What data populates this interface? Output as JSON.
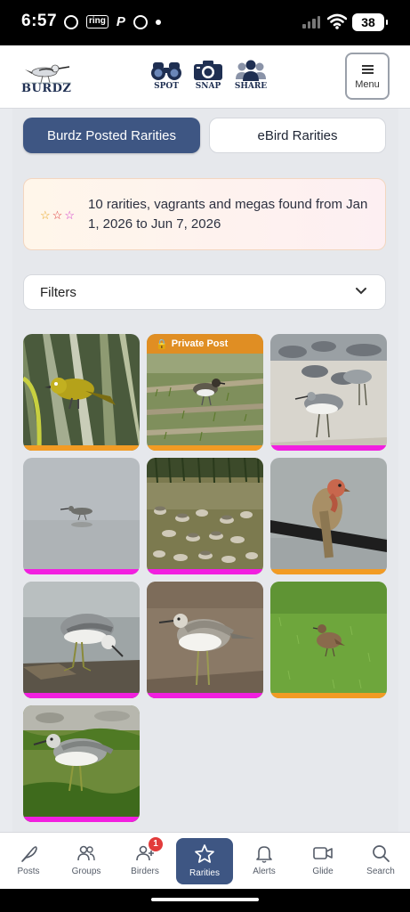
{
  "status_bar": {
    "time": "6:57",
    "ring_label": "ring",
    "battery": "38"
  },
  "header": {
    "logo_text": "BURDZ",
    "nav": [
      {
        "label": "SPOT",
        "icon": "binoculars-icon"
      },
      {
        "label": "SNAP",
        "icon": "camera-icon"
      },
      {
        "label": "SHARE",
        "icon": "people-icon"
      }
    ],
    "menu_label": "Menu"
  },
  "tabs": {
    "active": "Burdz Posted Rarities",
    "inactive": "eBird Rarities"
  },
  "info": {
    "stars": [
      "☆",
      "☆",
      "☆"
    ],
    "text": "10 rarities, vagrants and megas found from Jan 1, 2026 to Jun 7, 2026"
  },
  "filters": {
    "label": "Filters"
  },
  "gallery": {
    "private_label": "Private Post",
    "items": [
      {
        "subject": "yellow-bird-on-palm",
        "bar": "orange",
        "private": false
      },
      {
        "subject": "plover-on-grass",
        "bar": "orange",
        "private": true
      },
      {
        "subject": "shorebird-flock",
        "bar": "magenta",
        "private": false
      },
      {
        "subject": "wader-in-water",
        "bar": "magenta",
        "private": false
      },
      {
        "subject": "shorebirds-in-marsh",
        "bar": "magenta",
        "private": false
      },
      {
        "subject": "bird-on-rail",
        "bar": "orange",
        "private": false
      },
      {
        "subject": "greenshank-preening",
        "bar": "magenta",
        "private": false
      },
      {
        "subject": "greenshank-on-mud",
        "bar": "magenta",
        "private": false
      },
      {
        "subject": "bird-in-grass",
        "bar": "orange",
        "private": false
      },
      {
        "subject": "greenshank-on-algae",
        "bar": "magenta",
        "private": false
      }
    ]
  },
  "bottom_nav": {
    "items": [
      {
        "label": "Posts",
        "icon": "feather-icon"
      },
      {
        "label": "Groups",
        "icon": "groups-icon"
      },
      {
        "label": "Birders",
        "icon": "add-user-icon",
        "badge": "1"
      },
      {
        "label": "Rarities",
        "icon": "star-icon",
        "active": true
      },
      {
        "label": "Alerts",
        "icon": "bell-icon"
      },
      {
        "label": "Glide",
        "icon": "video-icon"
      },
      {
        "label": "Search",
        "icon": "search-icon"
      }
    ]
  },
  "colors": {
    "primary": "#3e5683",
    "bar_orange": "#f29b24",
    "bar_magenta": "#f21fe0",
    "badge_red": "#e23b3b"
  }
}
